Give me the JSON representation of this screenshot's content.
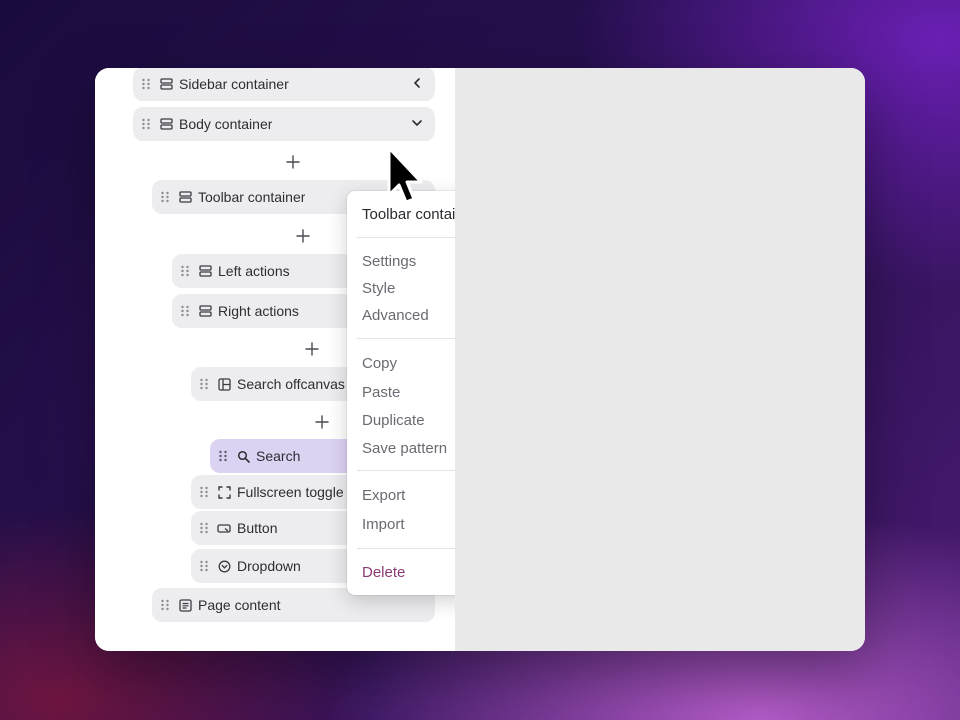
{
  "tree": {
    "nodes": [
      {
        "label": "Sidebar container",
        "icon": "rows-icon",
        "chevron": "chevron-left"
      },
      {
        "label": "Body container",
        "icon": "rows-icon",
        "chevron": "chevron-down"
      },
      {
        "label": "Toolbar container",
        "icon": "rows-icon"
      },
      {
        "label": "Left actions",
        "icon": "rows-icon"
      },
      {
        "label": "Right actions",
        "icon": "rows-icon"
      },
      {
        "label": "Search offcanvas",
        "icon": "layout-icon"
      },
      {
        "label": "Search",
        "icon": "search-icon",
        "selected": true
      },
      {
        "label": "Fullscreen toggle",
        "icon": "fullscreen-icon"
      },
      {
        "label": "Button",
        "icon": "button-icon"
      },
      {
        "label": "Dropdown",
        "icon": "dropdown-icon"
      },
      {
        "label": "Page content",
        "icon": "content-icon"
      }
    ]
  },
  "context_menu": {
    "title": "Toolbar container",
    "groups": [
      [
        {
          "label": "Settings",
          "icon": "sliders-icon"
        },
        {
          "label": "Style",
          "icon": "palette-icon"
        },
        {
          "label": "Advanced",
          "icon": "code-icon"
        }
      ],
      [
        {
          "label": "Copy",
          "icon": "chevron-right-icon"
        },
        {
          "label": "Paste",
          "icon": "chevron-right-icon"
        },
        {
          "label": "Duplicate",
          "icon": "duplicate-icon"
        },
        {
          "label": "Save pattern",
          "icon": "bookmark-icon"
        }
      ],
      [
        {
          "label": "Export",
          "icon": "chevron-right-icon"
        },
        {
          "label": "Import",
          "icon": "chevron-right-icon"
        }
      ],
      [
        {
          "label": "Delete",
          "icon": "trash-icon",
          "danger": true
        }
      ]
    ]
  },
  "colors": {
    "selected_node": "#dcd3f3",
    "danger": "#8a3b72",
    "canvas": "#e9e9ea"
  }
}
